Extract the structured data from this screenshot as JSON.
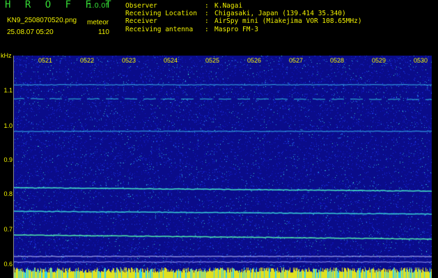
{
  "header": {
    "title": "H R O F F T",
    "version": "1.0.0f",
    "filename": "KN9_2508070520.png",
    "mode": "meteor",
    "datetime": "25.08.07 05:20",
    "count": "110"
  },
  "info": [
    {
      "label": "Observer",
      "value": "K.Nagai"
    },
    {
      "label": "Receiving Location",
      "value": "Chigasaki, Japan (139.414 35.340)"
    },
    {
      "label": "Receiver",
      "value": "AirSpy mini (Miakejima VOR 108.65MHz)"
    },
    {
      "label": "Receiving antenna",
      "value": "Maspro FM-3"
    }
  ],
  "axis": {
    "y_unit": "kHz",
    "y_ticks": [
      "1.1",
      "1.0",
      "0.9",
      "0.8",
      "0.7",
      "0.6"
    ],
    "x_ticks": [
      "0521",
      "0522",
      "0523",
      "0524",
      "0525",
      "0526",
      "0527",
      "0528",
      "0529",
      "0530"
    ]
  },
  "colors": {
    "background": "#000000",
    "text": "#f2f200",
    "title": "#34d834",
    "spectrogram_bg": "#0a0c8a",
    "trace": "#35e0e0"
  }
}
